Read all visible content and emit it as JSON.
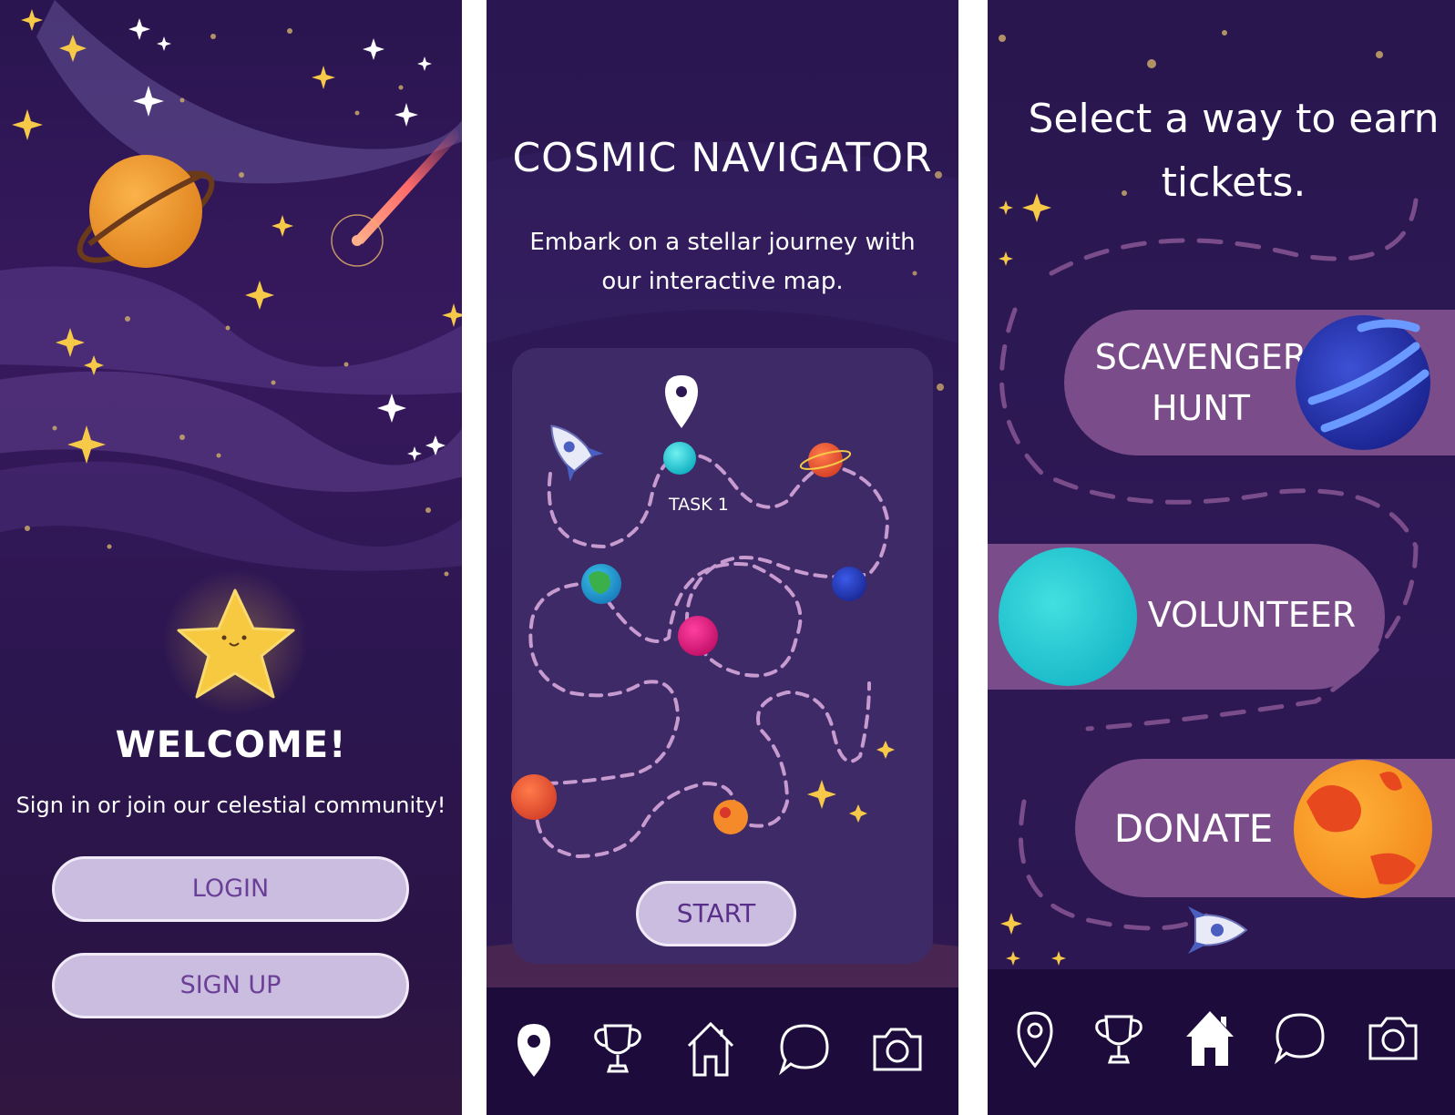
{
  "welcome_screen": {
    "title": "WELCOME!",
    "subtitle": "Sign in or join our celestial community!",
    "login_label": "LOGIN",
    "signup_label": "SIGN UP"
  },
  "map_screen": {
    "title": "COSMIC NAVIGATOR",
    "subtitle": "Embark on a stellar journey with our interactive map.",
    "task_label": "TASK 1",
    "start_label": "START",
    "nav": [
      "map-pin-icon",
      "trophy-icon",
      "home-icon",
      "chat-icon",
      "camera-icon"
    ],
    "active_nav": "map-pin-icon"
  },
  "earn_screen": {
    "title": "Select a way to earn tickets.",
    "options": [
      {
        "label_line1": "SCAVENGER",
        "label_line2": "HUNT"
      },
      {
        "label": "VOLUNTEER"
      },
      {
        "label": "DONATE"
      }
    ],
    "nav": [
      "map-pin-icon",
      "trophy-icon",
      "home-icon",
      "chat-icon",
      "camera-icon"
    ],
    "active_nav": "home-icon"
  },
  "colors": {
    "background": "#2c1752",
    "button_fill": "#cbbddf",
    "button_text": "#6a3f97",
    "pill_fill": "#7a4d8a",
    "nav_bar": "#1d0b3c",
    "star": "#f7c948"
  }
}
